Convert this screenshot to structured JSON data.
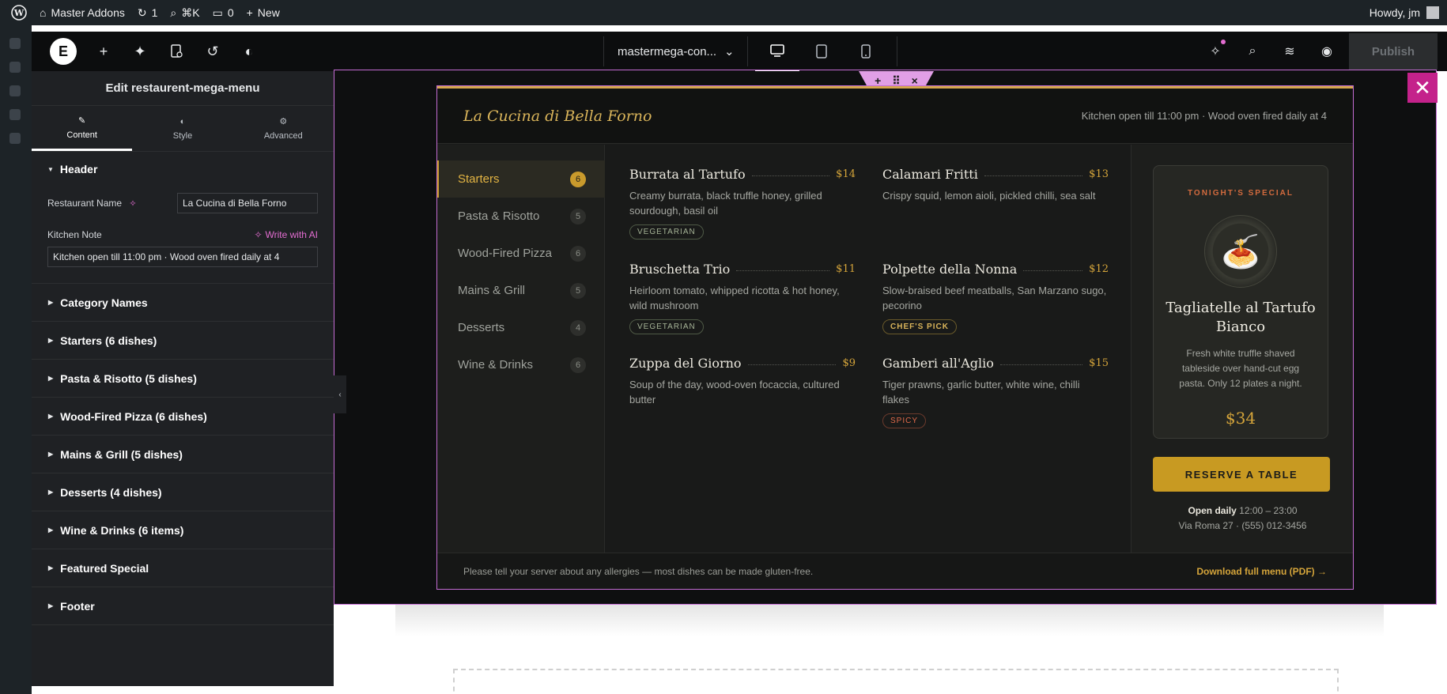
{
  "admin_bar": {
    "site_name": "Master Addons",
    "updates_count": "1",
    "search_shortcut": "⌘K",
    "comments_count": "0",
    "new_label": "New",
    "howdy": "Howdy, jm"
  },
  "editor": {
    "document_name": "mastermega-con...",
    "publish_label": "Publish"
  },
  "panel": {
    "title": "Edit restaurent-mega-menu",
    "tabs": [
      {
        "label": "Content",
        "icon": "pencil-icon",
        "active": true
      },
      {
        "label": "Style",
        "icon": "half-circle-icon",
        "active": false
      },
      {
        "label": "Advanced",
        "icon": "gear-icon",
        "active": false
      }
    ],
    "header_section": {
      "title": "Header",
      "restaurant_name_label": "Restaurant Name",
      "restaurant_name_value": "La Cucina di Bella Forno",
      "kitchen_note_label": "Kitchen Note",
      "write_ai_label": "Write with AI",
      "kitchen_note_value": "Kitchen open till 11:00 pm · Wood oven fired daily at 4"
    },
    "sections": [
      "Category Names",
      "Starters (6 dishes)",
      "Pasta & Risotto (5 dishes)",
      "Wood-Fired Pizza (6 dishes)",
      "Mains & Grill (5 dishes)",
      "Desserts (4 dishes)",
      "Wine & Drinks (6 items)",
      "Featured Special",
      "Footer"
    ]
  },
  "menu": {
    "restaurant_name": "La Cucina di Bella Forno",
    "kitchen_note": "Kitchen open till 11:00 pm · Wood oven fired daily at 4",
    "categories": [
      {
        "name": "Starters",
        "count": "6",
        "active": true
      },
      {
        "name": "Pasta & Risotto",
        "count": "5",
        "active": false
      },
      {
        "name": "Wood-Fired Pizza",
        "count": "6",
        "active": false
      },
      {
        "name": "Mains & Grill",
        "count": "5",
        "active": false
      },
      {
        "name": "Desserts",
        "count": "4",
        "active": false
      },
      {
        "name": "Wine & Drinks",
        "count": "6",
        "active": false
      }
    ],
    "dishes": [
      {
        "name": "Burrata al Tartufo",
        "price": "$14",
        "desc": "Creamy burrata, black truffle honey, grilled sourdough, basil oil",
        "tag": "VEGETARIAN",
        "tag_type": "veg"
      },
      {
        "name": "Calamari Fritti",
        "price": "$13",
        "desc": "Crispy squid, lemon aioli, pickled chilli, sea salt",
        "tag": "",
        "tag_type": ""
      },
      {
        "name": "Bruschetta Trio",
        "price": "$11",
        "desc": "Heirloom tomato, whipped ricotta & hot honey, wild mushroom",
        "tag": "VEGETARIAN",
        "tag_type": "veg"
      },
      {
        "name": "Polpette della Nonna",
        "price": "$12",
        "desc": "Slow-braised beef meatballs, San Marzano sugo, pecorino",
        "tag": "CHEF'S PICK",
        "tag_type": "chef"
      },
      {
        "name": "Zuppa del Giorno",
        "price": "$9",
        "desc": "Soup of the day, wood-oven focaccia, cultured butter",
        "tag": "",
        "tag_type": ""
      },
      {
        "name": "Gamberi all'Aglio",
        "price": "$15",
        "desc": "Tiger prawns, garlic butter, white wine, chilli flakes",
        "tag": "SPICY",
        "tag_type": "spicy"
      }
    ],
    "special": {
      "label": "TONIGHT'S SPECIAL",
      "icon": "pasta-plate-icon",
      "title": "Tagliatelle al Tartufo Bianco",
      "desc": "Fresh white truffle shaved tableside over hand-cut egg pasta. Only 12 plates a night.",
      "price": "$34"
    },
    "reserve_label": "RESERVE A TABLE",
    "hours_label": "Open daily",
    "hours_value": "12:00 – 23:00",
    "address": "Via Roma 27 · (555) 012-3456",
    "footer_note": "Please tell your server about any allergies — most dishes can be made gluten-free.",
    "pdf_link": "Download full menu (PDF) →"
  },
  "colors": {
    "accent_gold": "#c89a22",
    "ai_pink": "#e36dd1",
    "close_magenta": "#c4228b"
  }
}
